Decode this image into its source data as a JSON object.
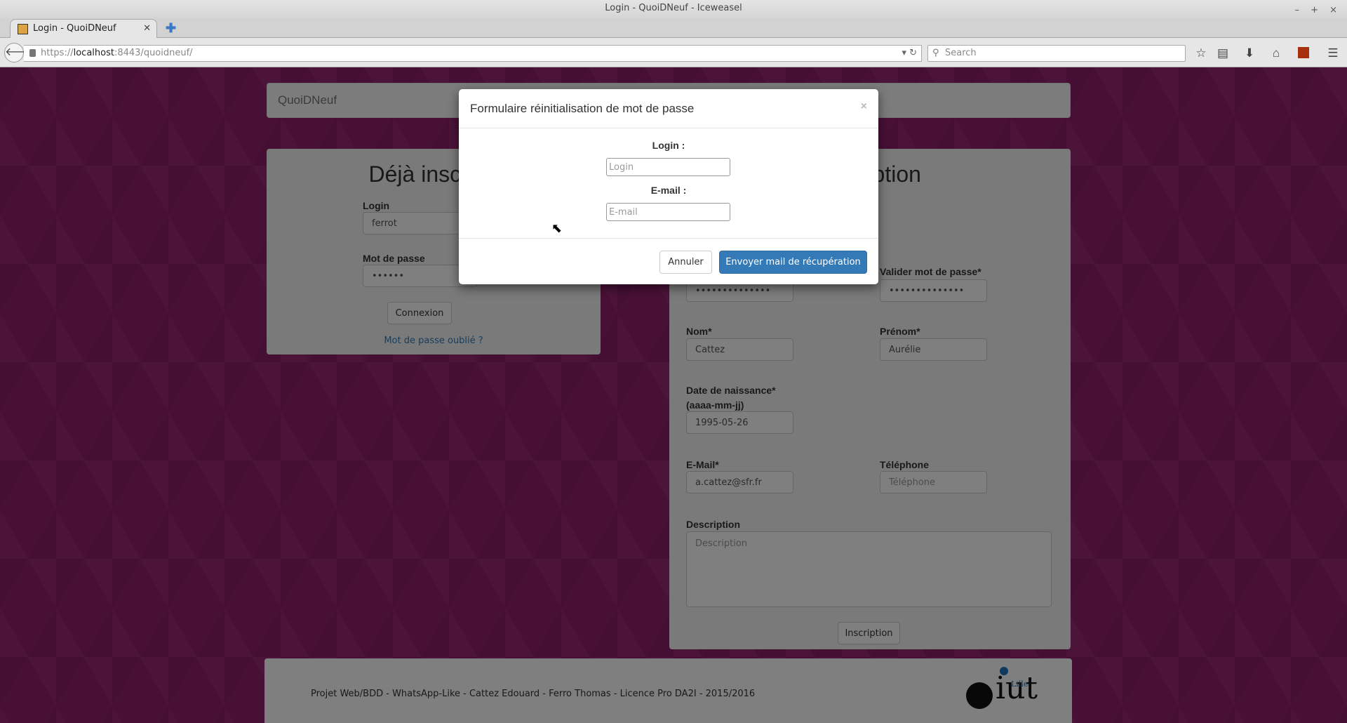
{
  "browser": {
    "window_title": "Login - QuoiDNeuf - Iceweasel",
    "window_controls": "– + ×",
    "tab_label": "Login - QuoiDNeuf",
    "url_prefix": "https://",
    "url_host": "localhost",
    "url_rest": ":8443/quoidneuf/",
    "search_placeholder": "Search",
    "toolbar_icons": [
      "star-icon",
      "reading-list-icon",
      "download-icon",
      "home-icon",
      "addon-icon",
      "menu-icon"
    ]
  },
  "navbar": {
    "brand": "QuoiDNeuf"
  },
  "login_panel": {
    "heading": "Déjà inscrit ?",
    "login_label": "Login",
    "login_value": "ferrot",
    "password_label": "Mot de passe",
    "password_value": "••••••",
    "submit": "Connexion",
    "forgot_link": "Mot de passe oublié ?"
  },
  "signup_panel": {
    "heading": "Inscription",
    "password_value": "••••••••••••••",
    "confirm_label": "Valider mot de passe*",
    "confirm_value": "••••••••••••••",
    "nom_label": "Nom*",
    "nom_value": "Cattez",
    "prenom_label": "Prénom*",
    "prenom_value": "Aurélie",
    "dob_label": "Date de naissance*",
    "dob_hint": "(aaaa-mm-jj)",
    "dob_value": "1995-05-26",
    "email_label": "E-Mail*",
    "email_value": "a.cattez@sfr.fr",
    "phone_label": "Téléphone",
    "phone_placeholder": "Téléphone",
    "desc_label": "Description",
    "desc_placeholder": "Description",
    "submit": "Inscription"
  },
  "modal": {
    "title": "Formulaire réinitialisation de mot de passe",
    "close": "×",
    "login_label": "Login :",
    "login_placeholder": "Login",
    "email_label": "E-mail :",
    "email_placeholder": "E-mail",
    "cancel": "Annuler",
    "submit": "Envoyer mail de récupération",
    "primary_color": "#337ab7"
  },
  "footer": {
    "text": "Projet Web/BDD - WhatsApp-Like - Cattez Edouard - Ferro Thomas - Licence Pro DA2I - 2015/2016",
    "logo_text": "iut",
    "logo_sub": "Lille"
  }
}
